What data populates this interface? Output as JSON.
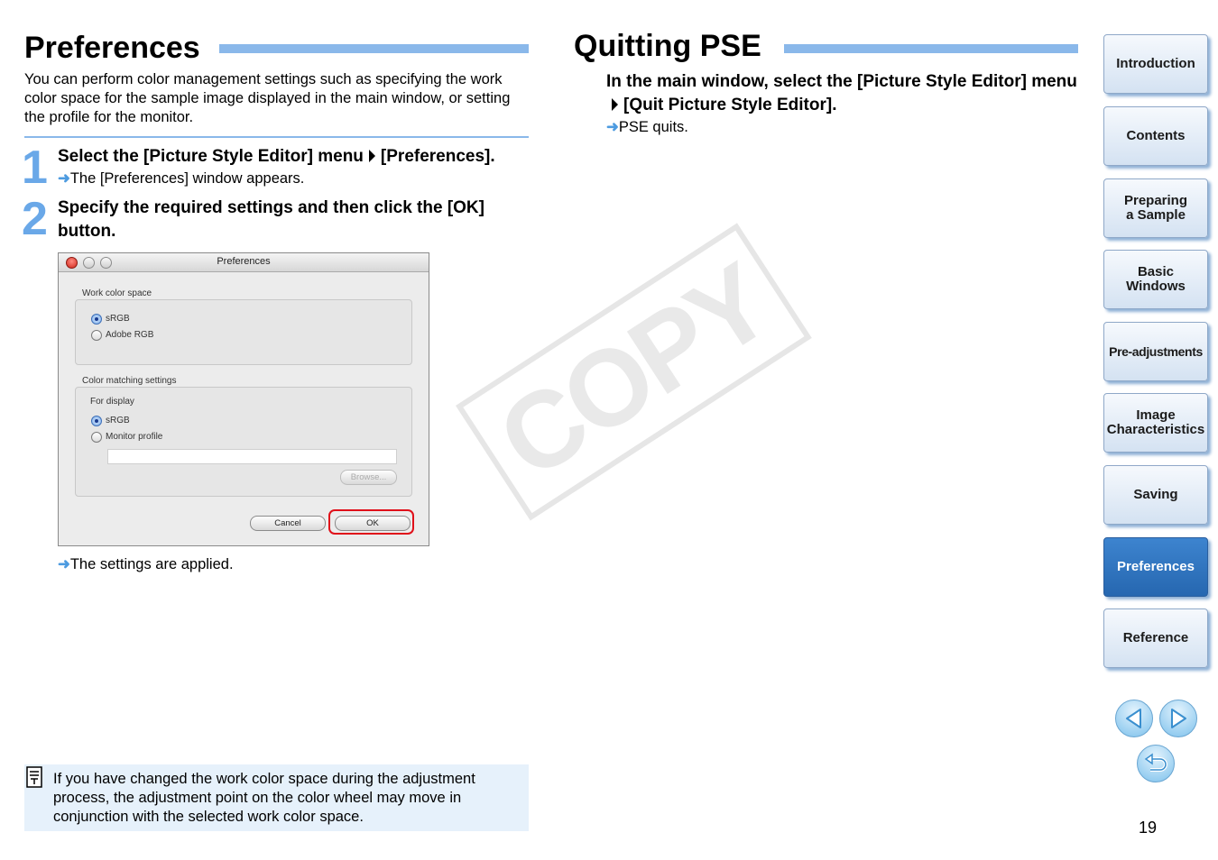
{
  "left": {
    "title": "Preferences",
    "intro": "You can perform color management settings such as specifying the work color space for the sample image displayed in the main window, or setting the profile for the monitor.",
    "step1": {
      "num": "1",
      "title_part1": "Select the [Picture Style Editor] menu",
      "title_part2": "[Preferences].",
      "result": "The [Preferences] window appears."
    },
    "step2": {
      "num": "2",
      "title": "Specify the required settings and then click the [OK] button.",
      "result": "The settings are applied."
    },
    "note": "If you have changed the work color space during the adjustment process, the adjustment point on the color wheel may move in conjunction with the selected work color space."
  },
  "dialog": {
    "title": "Preferences",
    "work_color_space_label": "Work color space",
    "opt_srgb": "sRGB",
    "opt_adobe": "Adobe RGB",
    "color_matching_label": "Color matching settings",
    "for_display_label": "For display",
    "opt_srgb2": "sRGB",
    "opt_monitor": "Monitor profile",
    "browse": "Browse...",
    "cancel": "Cancel",
    "ok": "OK"
  },
  "right": {
    "title": "Quitting PSE",
    "step_part1": "In the main window, select the [Picture Style Editor] menu",
    "step_part2": "[Quit Picture Style Editor].",
    "result": "PSE quits."
  },
  "watermark": "COPY",
  "nav": {
    "introduction": "Introduction",
    "contents": "Contents",
    "preparing1": "Preparing",
    "preparing2": "a Sample",
    "basic1": "Basic",
    "basic2": "Windows",
    "preadj": "Pre-adjustments",
    "image1": "Image",
    "image2": "Characteristics",
    "saving": "Saving",
    "preferences": "Preferences",
    "reference": "Reference"
  },
  "page_number": "19",
  "colors": {
    "accent": "#8ab8ea",
    "active_nav": "#2f74c0",
    "note_bg": "#e6f1fb"
  }
}
